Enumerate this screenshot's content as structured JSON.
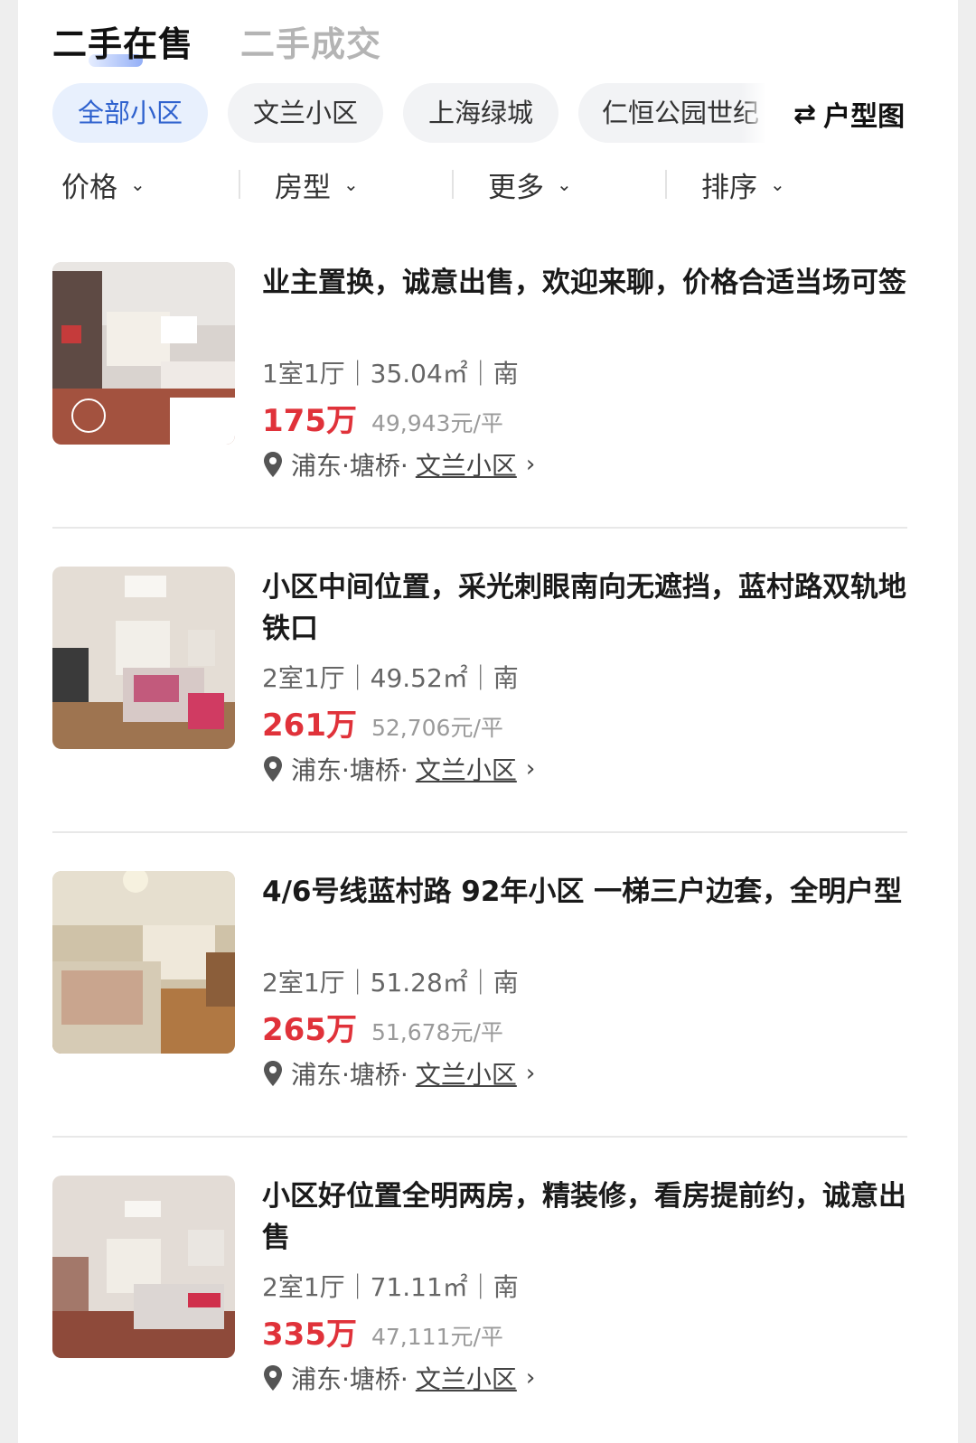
{
  "tabs": {
    "active": "二手在售",
    "inactive": "二手成交"
  },
  "chips": [
    "全部小区",
    "文兰小区",
    "上海绿城",
    "仁恒公园世纪"
  ],
  "floorplan": {
    "icon": "swap-arrows-icon",
    "label": "户型图"
  },
  "filters": [
    "价格",
    "房型",
    "更多",
    "排序"
  ],
  "colors": {
    "price": "#e0323a",
    "accent": "#2f62ce",
    "chip_selected_bg": "#e8f0fd"
  },
  "listings": [
    {
      "title": "业主置换，诚意出售，欢迎来聊，价格合适当场可签",
      "meta": "1室1厅｜35.04㎡｜南",
      "price": "175万",
      "unit_price": "49,943元/平",
      "location": "浦东·塘桥·",
      "community": "文兰小区"
    },
    {
      "title": "小区中间位置，采光刺眼南向无遮挡，蓝村路双轨地铁口",
      "meta": "2室1厅｜49.52㎡｜南",
      "price": "261万",
      "unit_price": "52,706元/平",
      "location": "浦东·塘桥·",
      "community": "文兰小区"
    },
    {
      "title": "4/6号线蓝村路 92年小区 一梯三户边套，全明户型",
      "meta": "2室1厅｜51.28㎡｜南",
      "price": "265万",
      "unit_price": "51,678元/平",
      "location": "浦东·塘桥·",
      "community": "文兰小区"
    },
    {
      "title": "小区好位置全明两房，精装修，看房提前约，诚意出售",
      "meta": "2室1厅｜71.11㎡｜南",
      "price": "335万",
      "unit_price": "47,111元/平",
      "location": "浦东·塘桥·",
      "community": "文兰小区"
    }
  ]
}
